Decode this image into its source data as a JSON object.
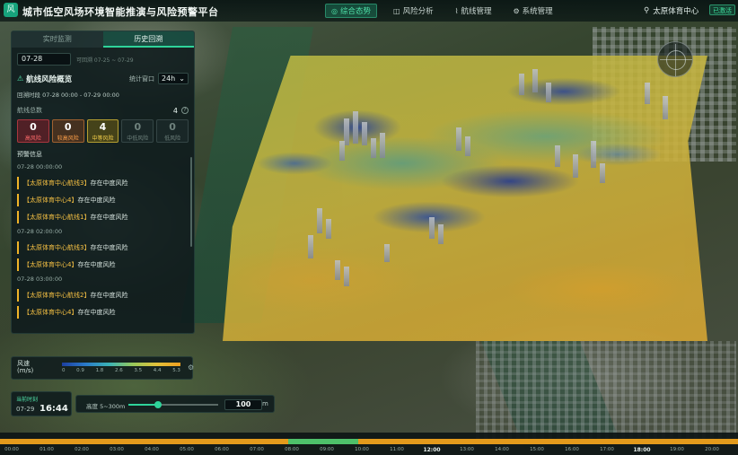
{
  "app": {
    "title": "城市低空风场环境智能推演与风险预警平台",
    "logo_glyph": "风"
  },
  "nav": {
    "items": [
      {
        "label": "综合态势",
        "icon": "grid-icon",
        "glyph": "◎",
        "active": true
      },
      {
        "label": "风险分析",
        "icon": "chart-icon",
        "glyph": "◫"
      },
      {
        "label": "航线管理",
        "icon": "route-icon",
        "glyph": "⌇"
      },
      {
        "label": "系统管理",
        "icon": "gear-icon",
        "glyph": "⚙"
      }
    ]
  },
  "location": {
    "glyph": "⚲",
    "name": "太原体育中心",
    "status": "已激活"
  },
  "panel": {
    "tabs": [
      "实时监测",
      "历史回溯"
    ],
    "date": {
      "value": "07-28",
      "range_hint": "可回溯 07-25 ~ 07-29"
    },
    "section_title": "航线风险概览",
    "window_label": "统计窗口",
    "window_value": "24h",
    "period_label": "回溯时段",
    "period_value": "07-28 00:00 - 07-29 00:00",
    "count_label": "航线总数",
    "count_value": "4",
    "levels": [
      {
        "num": "0",
        "label": "高风险",
        "class": "high"
      },
      {
        "num": "0",
        "label": "较高风险",
        "class": "mhigh"
      },
      {
        "num": "4",
        "label": "中等风险",
        "class": "mid"
      },
      {
        "num": "0",
        "label": "中低风险",
        "class": "low"
      },
      {
        "num": "0",
        "label": "低风险",
        "class": "low"
      }
    ],
    "alerts_title": "预警信息",
    "alert_groups": [
      {
        "time": "07-28 00:00:00",
        "items": [
          {
            "route": "【太原体育中心航线3】",
            "text": "存在中度风险"
          },
          {
            "route": "【太原体育中心4】",
            "text": "存在中度风险"
          },
          {
            "route": "【太原体育中心航线1】",
            "text": "存在中度风险"
          }
        ]
      },
      {
        "time": "07-28 02:00:00",
        "items": [
          {
            "route": "【太原体育中心航线3】",
            "text": "存在中度风险"
          },
          {
            "route": "【太原体育中心4】",
            "text": "存在中度风险"
          }
        ]
      },
      {
        "time": "07-28 03:00:00",
        "items": [
          {
            "route": "【太原体育中心航线2】",
            "text": "存在中度风险"
          },
          {
            "route": "【太原体育中心4】",
            "text": "存在中度风险"
          }
        ]
      }
    ]
  },
  "legend": {
    "title_1": "风速",
    "title_2": "(m/s)",
    "ticks": [
      "0",
      "0.9",
      "1.8",
      "2.6",
      "3.5",
      "4.4",
      "5.3"
    ]
  },
  "current_time": {
    "label": "当前时刻",
    "date": "07-29",
    "clock": "16:44"
  },
  "altitude": {
    "label": "高度 5~300m",
    "value": "100",
    "unit": "m",
    "fraction": 0.33
  },
  "timeline": {
    "ticks": [
      "00:00",
      "01:00",
      "02:00",
      "03:00",
      "04:00",
      "05:00",
      "06:00",
      "07:00",
      "08:00",
      "09:00",
      "10:00",
      "11:00",
      "12:00",
      "13:00",
      "14:00",
      "15:00",
      "16:00",
      "17:00",
      "18:00",
      "19:00",
      "20:00",
      "21:00"
    ],
    "major": [
      "12:00",
      "18:00"
    ],
    "highlight_start_hour": 7.9,
    "highlight_end_hour": 9.9
  },
  "colors": {
    "accent": "#2fd39a",
    "warning": "#f0b428",
    "timeline": "#e39a1c"
  }
}
